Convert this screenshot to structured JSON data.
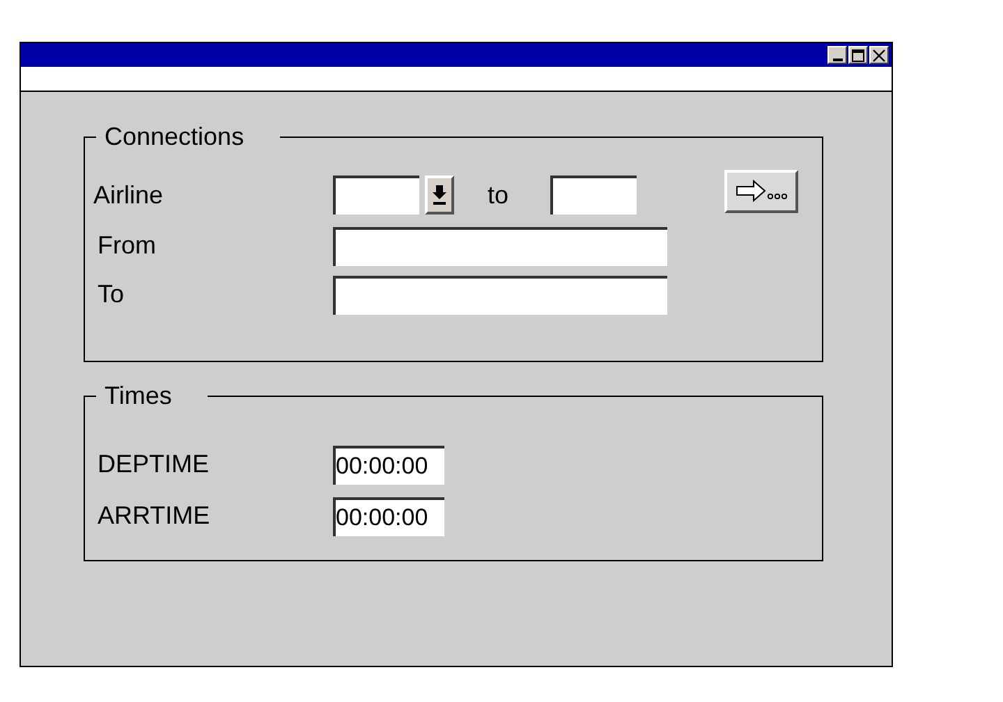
{
  "window": {
    "controls": [
      {
        "kind": "minimize"
      },
      {
        "kind": "maximize"
      },
      {
        "kind": "close"
      }
    ]
  },
  "connections": {
    "title": "Connections",
    "airline": {
      "label": "Airline",
      "separator": "to"
    },
    "fields": [
      {
        "label": "From"
      },
      {
        "label": "To"
      }
    ]
  },
  "times": {
    "title": "Times",
    "fields": [
      {
        "label": "DEPTIME",
        "value": "00:00:00"
      },
      {
        "label": "ARRTIME",
        "value": "00:00:00"
      }
    ]
  }
}
